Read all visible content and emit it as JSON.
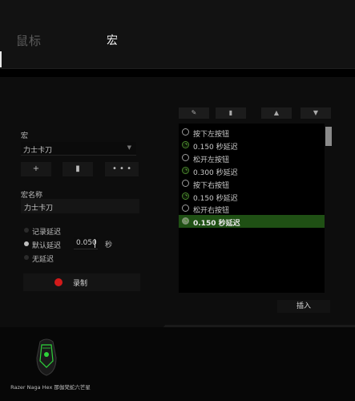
{
  "tabs": {
    "mouse": "鼠标",
    "macro": "宏"
  },
  "macro": {
    "label": "宏",
    "selected": "力士卡刀",
    "buttons": {
      "add": "+",
      "delete": "▮",
      "more": "• • •"
    }
  },
  "name": {
    "label": "宏名称",
    "value": "力士卡刀"
  },
  "delay": {
    "options": [
      "记录延迟",
      "默认延迟",
      "无延迟"
    ],
    "selected_index": 1,
    "value": "0.050",
    "unit": "秒"
  },
  "record": {
    "label": "录制"
  },
  "toolbar": {
    "edit": "✎",
    "delete": "▮",
    "up": "▲",
    "down": "▼"
  },
  "events": [
    {
      "type": "mouse",
      "text": "按下左按钮"
    },
    {
      "type": "delay",
      "text": "0.150 秒延迟"
    },
    {
      "type": "mouse",
      "text": "松开左按钮"
    },
    {
      "type": "delay",
      "text": "0.300 秒延迟"
    },
    {
      "type": "mouse",
      "text": "按下右按钮"
    },
    {
      "type": "delay",
      "text": "0.150 秒延迟"
    },
    {
      "type": "mouse",
      "text": "松开右按钮"
    },
    {
      "type": "delay",
      "text": "0.150 秒延迟",
      "selected": true
    }
  ],
  "insert": {
    "label": "插入"
  },
  "device": {
    "name": "Razer Naga Hex 那伽梵蛇六芒星"
  },
  "colors": {
    "accent": "#4e8f2f",
    "selected_row": "#1f5014",
    "record_dot": "#d21a1a"
  }
}
